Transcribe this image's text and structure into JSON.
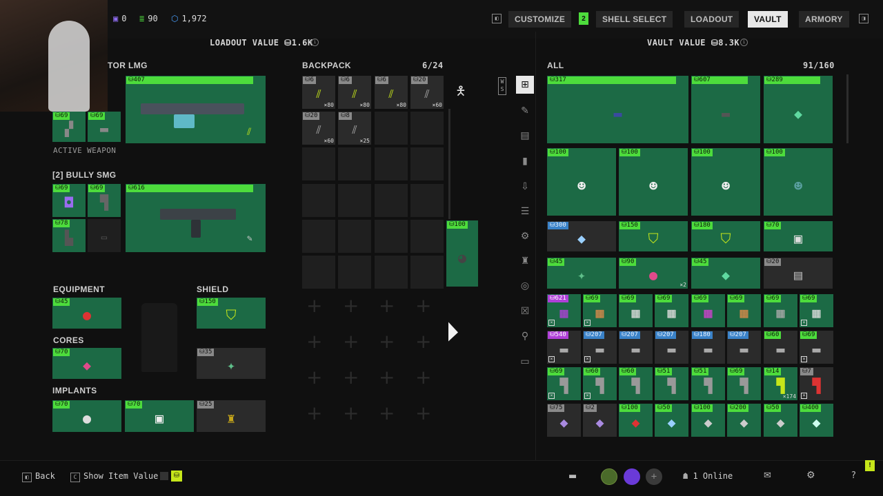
{
  "currencies": [
    {
      "icon": "purple-box-icon",
      "value": "0"
    },
    {
      "icon": "green-stack-icon",
      "value": "90"
    },
    {
      "icon": "blue-gem-icon",
      "value": "1,972"
    }
  ],
  "nav": {
    "customize": "CUSTOMIZE",
    "customize_badge": "2",
    "shell_select": "SHELL SELECT",
    "loadout": "LOADOUT",
    "vault": "VAULT",
    "armory": "ARMORY",
    "active": "VAULT"
  },
  "loadout_value": "LOADOUT VALUE ⛁1.6K",
  "vault_value": "VAULT VALUE ⛁8.3K",
  "weapon1": {
    "name": "TOR LMG",
    "price": "407",
    "mods": [
      "69",
      "69"
    ],
    "status": "ACTIVE WEAPON"
  },
  "weapon2": {
    "name": "[2] BULLY SMG",
    "price": "616",
    "mods": [
      "69",
      "69",
      "78"
    ]
  },
  "equipment": {
    "title": "EQUIPMENT",
    "price": "45"
  },
  "shield": {
    "title": "SHIELD",
    "price": "150"
  },
  "cores": {
    "title": "CORES",
    "price": "70",
    "extra_price": "35"
  },
  "implants": {
    "title": "IMPLANTS",
    "prices": [
      "70",
      "70",
      "25"
    ]
  },
  "backpack": {
    "title": "BACKPACK",
    "count": "6/24",
    "items": [
      {
        "price": "6",
        "qty": "×80",
        "color": "grey"
      },
      {
        "price": "6",
        "qty": "×80",
        "color": "grey"
      },
      {
        "price": "6",
        "qty": "×80",
        "color": "grey"
      },
      {
        "price": "20",
        "qty": "×60",
        "color": "grey"
      },
      {
        "price": "20",
        "qty": "×60",
        "color": "grey"
      },
      {
        "price": "8",
        "qty": "×25",
        "color": "grey"
      }
    ],
    "side_item_price": "100"
  },
  "vault": {
    "title": "ALL",
    "count": "91/160",
    "row1": [
      "317",
      "607",
      "289"
    ],
    "row2": [
      "100",
      "100",
      "100",
      "100"
    ],
    "row3": [
      "300",
      "150",
      "180",
      "70"
    ],
    "row4": [
      "45",
      "90",
      "45",
      "20"
    ],
    "row4_qty": "×2",
    "row5": [
      "621",
      "69",
      "69",
      "69",
      "69",
      "69",
      "69",
      "69"
    ],
    "row6": [
      "540",
      "207",
      "207",
      "207",
      "180",
      "207",
      "60",
      "69"
    ],
    "row7": [
      "69",
      "60",
      "60",
      "51",
      "51",
      "69",
      "14",
      "7"
    ],
    "row7_qty": "×174",
    "row8": [
      "75",
      "2",
      "100",
      "50",
      "100",
      "200",
      "50",
      "400"
    ]
  },
  "footer": {
    "back": "Back",
    "show_item_value": "Show Item Value",
    "online": "1 Online"
  },
  "colors": {
    "accent_green": "#4ddc3c",
    "tile_green": "#1c6a45",
    "blue": "#3a82c8",
    "purple": "#b040d8"
  }
}
